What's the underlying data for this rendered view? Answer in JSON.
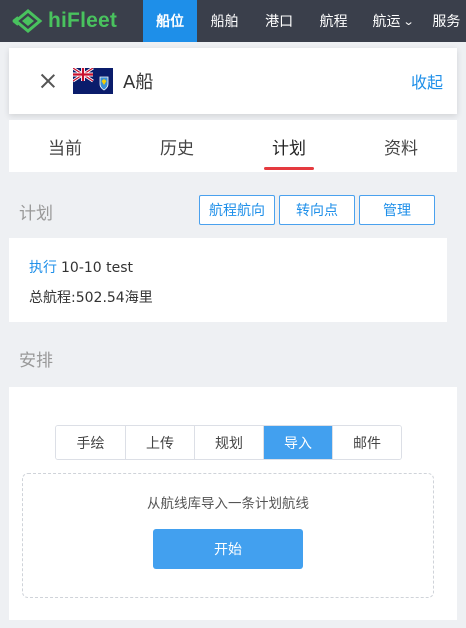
{
  "topnav": {
    "brand": "hiFleet",
    "items": [
      {
        "label": "船位",
        "active": true
      },
      {
        "label": "船舶"
      },
      {
        "label": "港口"
      },
      {
        "label": "航程"
      },
      {
        "label": "航运"
      },
      {
        "label": "服务"
      }
    ],
    "brand_color": "#49c25e",
    "active_color": "#1e8fe9"
  },
  "vessel": {
    "name": "A船",
    "collapse_label": "收起",
    "flag_icon": "flag-icon"
  },
  "tabs": [
    "当前",
    "历史",
    "计划",
    "资料"
  ],
  "active_tab": "计划",
  "plan": {
    "title": "计划",
    "buttons": [
      "航程航向",
      "转向点",
      "管理"
    ],
    "exec_label": "执行",
    "plan_name": "10-10 test",
    "distance_text": "总航程:502.54海里"
  },
  "arrange": {
    "title": "安排",
    "options": [
      "手绘",
      "上传",
      "规划",
      "导入",
      "邮件"
    ],
    "selected": "导入",
    "hint": "从航线库导入一条计划航线",
    "start_label": "开始",
    "accent_color": "#42a0ef"
  }
}
